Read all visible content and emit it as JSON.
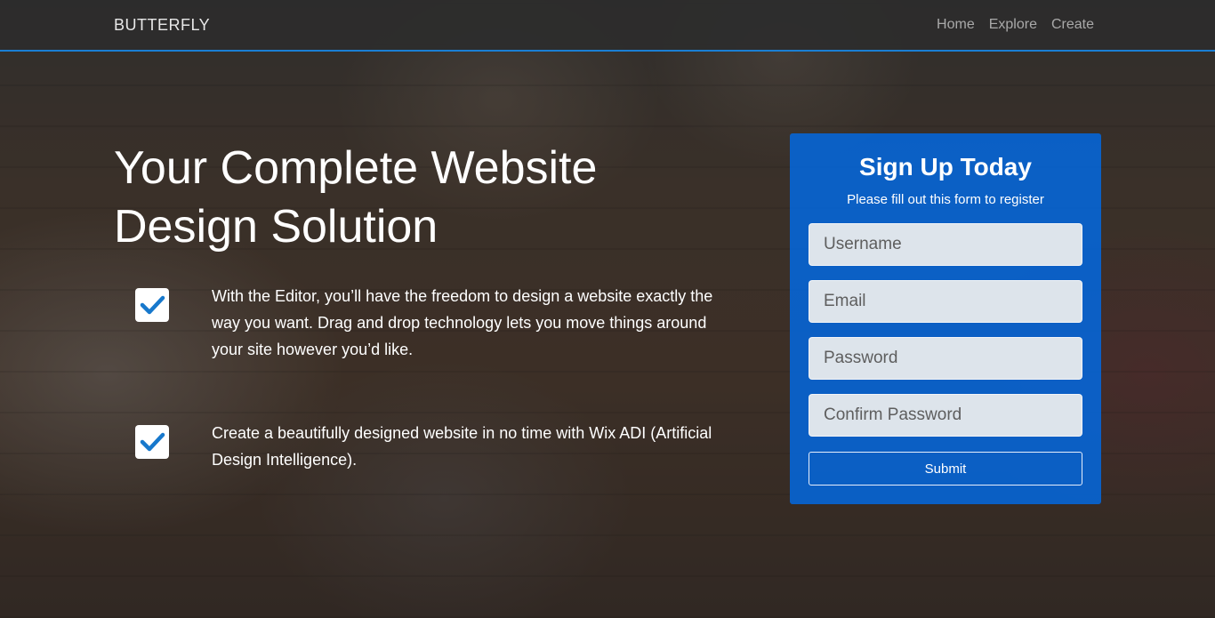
{
  "navbar": {
    "brand": "BUTTERFLY",
    "links": [
      "Home",
      "Explore",
      "Create"
    ]
  },
  "hero": {
    "title_light": "Your ",
    "title_strong": "Complete Website",
    "title_line2": "Design Solution"
  },
  "features": [
    {
      "icon": "checkbox-checked-icon",
      "text": "With the Editor, you’ll have the freedom to design a website exactly the way you want. Drag and drop technology lets you move things around your site however you’d like."
    },
    {
      "icon": "checkbox-checked-icon",
      "text": "Create a beautifully designed website in no time with Wix ADI (Artificial Design Intelligence)."
    }
  ],
  "signup": {
    "title": "Sign Up Today",
    "subtitle": "Please fill out this form to register",
    "username_placeholder": "Username",
    "email_placeholder": "Email",
    "password_placeholder": "Password",
    "confirm_placeholder": "Confirm Password",
    "submit_label": "Submit"
  },
  "colors": {
    "accent": "#1a7fd4",
    "card": "#0566db",
    "check": "#1778cc"
  }
}
